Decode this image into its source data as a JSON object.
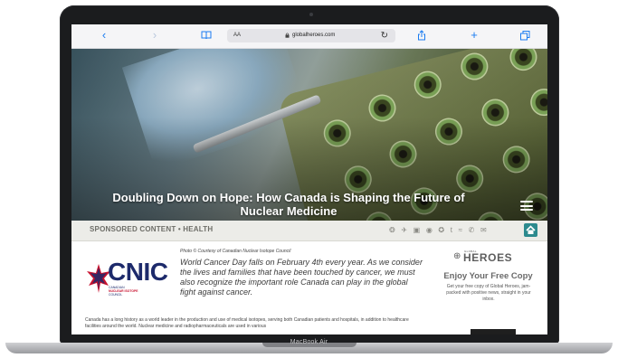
{
  "browser": {
    "back_icon": "chevron-left-icon",
    "forward_icon": "chevron-right-icon",
    "bookmarks_icon": "book-icon",
    "text_size_label": "AA",
    "url": "globalheroes.com",
    "reload_icon": "reload-icon",
    "share_icon": "share-icon",
    "new_tab_icon": "plus-icon",
    "tabs_icon": "tabs-icon"
  },
  "hero": {
    "title": "Doubling Down on Hope: How Canada is Shaping the Future of Nuclear Medicine",
    "menu_icon": "hamburger-menu-icon"
  },
  "category_bar": {
    "label": "SPONSORED CONTENT • HEALTH",
    "share_icons": [
      "pinterest-icon",
      "twitter-icon",
      "linkedin-icon",
      "reddit-icon",
      "email-icon",
      "tumblr-icon",
      "vk-icon",
      "whatsapp-icon",
      "sms-icon"
    ],
    "share_glyphs": "❂ ✈ ▣ ◉ ✪ t ≈ ✆ ✉",
    "home_icon": "home-icon",
    "home_color": "#2c8a8e"
  },
  "article": {
    "logo": {
      "name": "CNIC",
      "subtitle_line1": "CANADIAN",
      "subtitle_line2": "NUCLEAR ISOTOPE",
      "subtitle_line3": "COUNCIL",
      "brand_color": "#1d2a6b",
      "accent_color": "#c8102e"
    },
    "photo_credit": "Photo © Courtesy of Canadian Nuclear Isotope Council",
    "lead": "World Cancer Day falls on February 4th every year. As we consider the lives and families that have been touched by cancer, we must also recognize the important role Canada can play in the global fight against cancer.",
    "body": "Canada has a long history as a world leader in the production and use of medical isotopes, serving both Canadian patients and hospitals, in addition to healthcare facilities around the world. Nuclear medicine and radiopharmaceuticals are used in various"
  },
  "sidebar": {
    "brand_small": "GLOBAL",
    "brand_large": "HEROES",
    "heading": "Enjoy Your Free Copy",
    "description": "Get your free copy of Global Heroes, jam-packed with positive news, straight in your inbox."
  },
  "device": {
    "label": "MacBook Air"
  }
}
